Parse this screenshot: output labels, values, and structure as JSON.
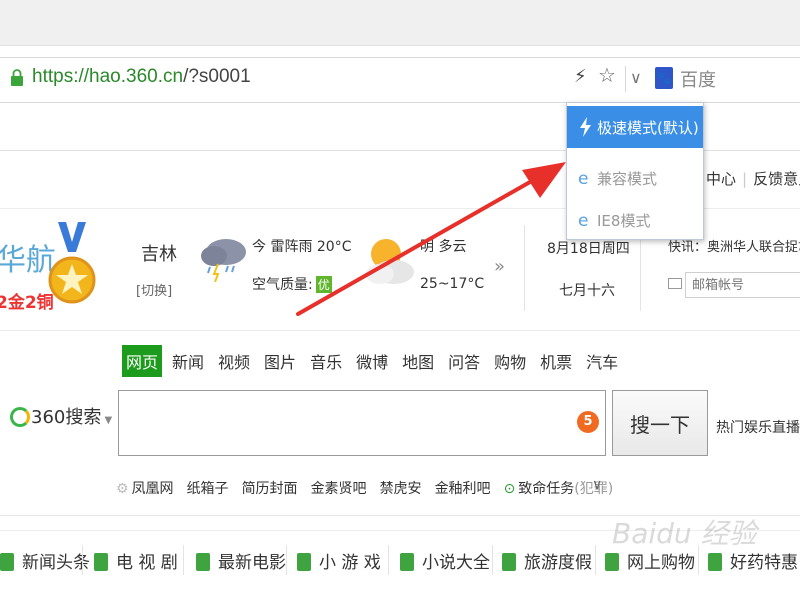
{
  "address_bar": {
    "url_scheme": "https://",
    "url_host": "hao.360.cn",
    "url_rest": "/?s0001",
    "search_engine": "百度"
  },
  "speed_menu": {
    "items": [
      {
        "label": "极速模式(默认)",
        "selected": true,
        "icon": "lightning-icon"
      },
      {
        "label": "兼容模式",
        "selected": false,
        "icon": "ie-icon"
      },
      {
        "label": "IE8模式",
        "selected": false,
        "icon": "ie-icon"
      }
    ]
  },
  "help_links": [
    "中心",
    "反馈意见"
  ],
  "banner": {
    "partial_title": "华航",
    "medals": "2金2铜"
  },
  "weather": {
    "city": "吉林",
    "switch": "[切换]",
    "today": "今 雷阵雨 20°C",
    "air_quality_label": "空气质量:",
    "air_quality_value": "优",
    "tomorrow": "明 多云",
    "tomorrow_temp": "25~17°C",
    "more": "»"
  },
  "date": {
    "solar": "8月18日周四",
    "lunar": "七月十六"
  },
  "news_ticker": "快讯：奥洲华人联合捉拿宋",
  "mail": {
    "placeholder": "邮箱帐号"
  },
  "search": {
    "tabs": [
      "网页",
      "新闻",
      "视频",
      "图片",
      "音乐",
      "微博",
      "地图",
      "问答",
      "购物",
      "机票",
      "汽车"
    ],
    "active_tab": "网页",
    "logo_text": "360搜索",
    "badge": "5",
    "button": "搜一下",
    "hot": "热门娱乐直播平台",
    "quick_links": [
      "凤凰网",
      "纸箱子",
      "简历封面",
      "金素贤吧",
      "禁虎安",
      "金釉利吧"
    ],
    "mission_label": "致命任务",
    "mission_note": "(犯罪)"
  },
  "categories": [
    "新闻头条",
    "电 视 剧",
    "最新电影",
    "小 游 戏",
    "小说大全",
    "旅游度假",
    "网上购物",
    "好药特惠"
  ],
  "watermark": "Baidu 经验",
  "colors": {
    "green_active": "#1d9b1d",
    "menu_selected": "#3a8ee6",
    "arrow": "#e8302a",
    "badge": "#f06a22"
  }
}
